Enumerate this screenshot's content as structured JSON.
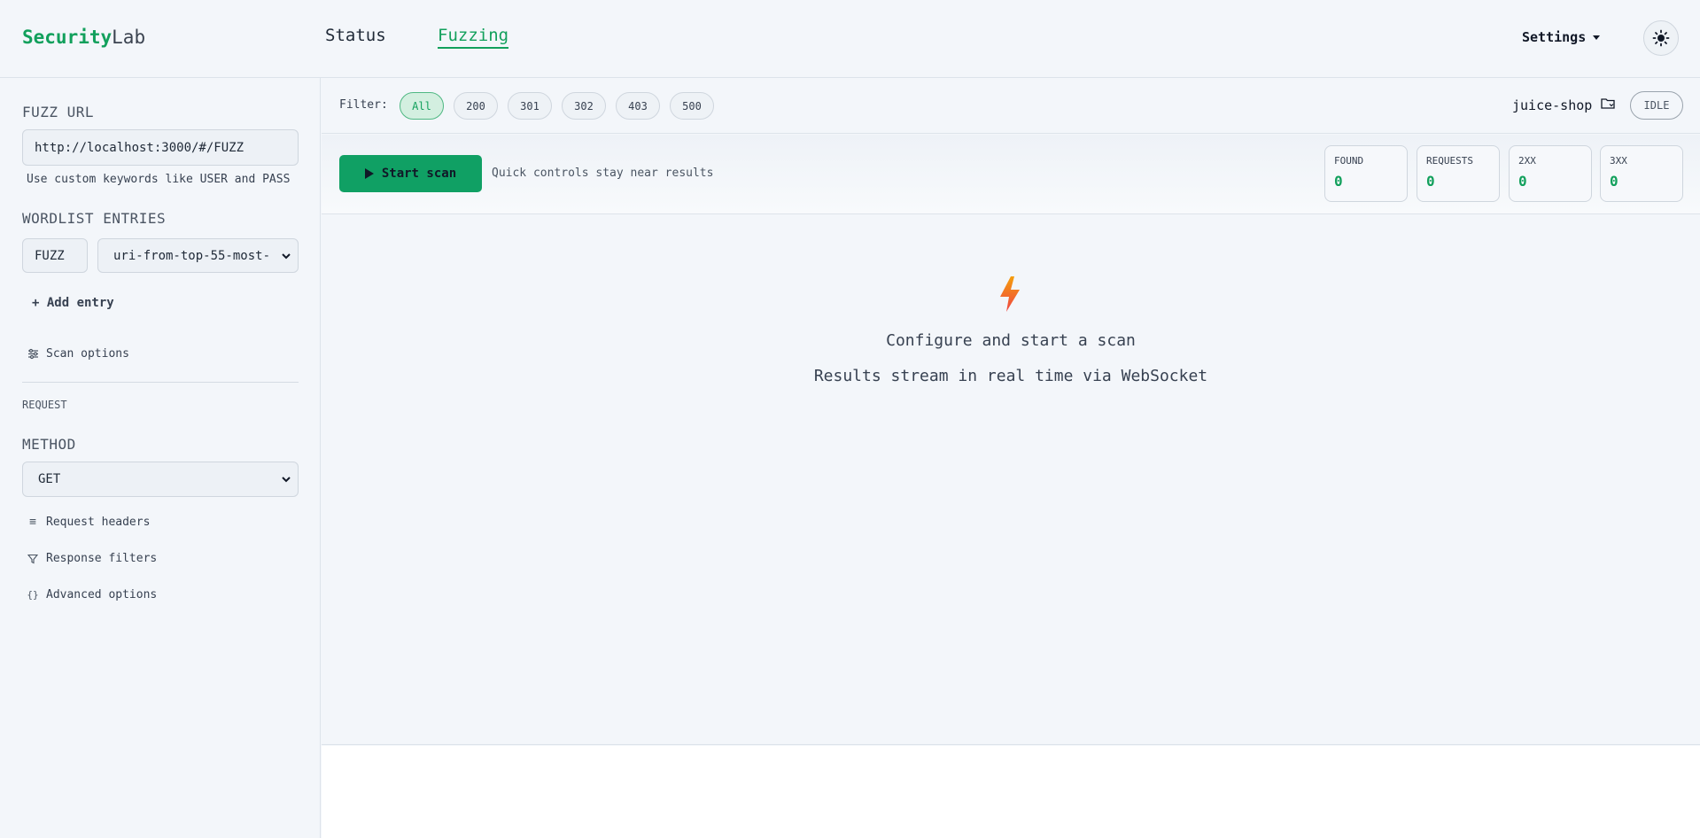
{
  "brand": {
    "part1": "Security",
    "part2": "Lab"
  },
  "nav": {
    "tabs": [
      {
        "label": "Status"
      },
      {
        "label": "Fuzzing"
      }
    ],
    "active": "Fuzzing"
  },
  "header": {
    "settings_label": "Settings",
    "theme_icon": "sun-icon"
  },
  "sidebar": {
    "fuzz_url_label": "FUZZ URL",
    "fuzz_url_value": "http://localhost:3000/#/FUZZ",
    "fuzz_url_hint": "Use custom keywords like USER and PASS",
    "wordlist_label": "WORDLIST ENTRIES",
    "wordlist_keyword": "FUZZ",
    "wordlist_selected": "uri-from-top-55-most-",
    "add_entry": "+ Add entry",
    "scan_options": "Scan options",
    "request_section": "REQUEST",
    "method_label": "METHOD",
    "method_value": "GET",
    "request_headers": "Request headers",
    "response_filters": "Response filters",
    "advanced_options": "Advanced options"
  },
  "filter": {
    "label": "Filter:",
    "chips": [
      "All",
      "200",
      "301",
      "302",
      "403",
      "500"
    ],
    "active": "All",
    "project": "juice-shop",
    "status": "IDLE"
  },
  "controls": {
    "start_label": "Start scan",
    "hint": "Quick controls stay near results",
    "stats": [
      {
        "label": "FOUND",
        "value": "0"
      },
      {
        "label": "REQUESTS",
        "value": "0"
      },
      {
        "label": "2XX",
        "value": "0"
      },
      {
        "label": "3XX",
        "value": "0"
      }
    ]
  },
  "empty_state": {
    "icon": "lightning-icon",
    "title": "Configure and start a scan",
    "subtitle": "Results stream in real time via WebSocket"
  },
  "colors": {
    "accent": "#12a05c",
    "button": "#10a064"
  }
}
